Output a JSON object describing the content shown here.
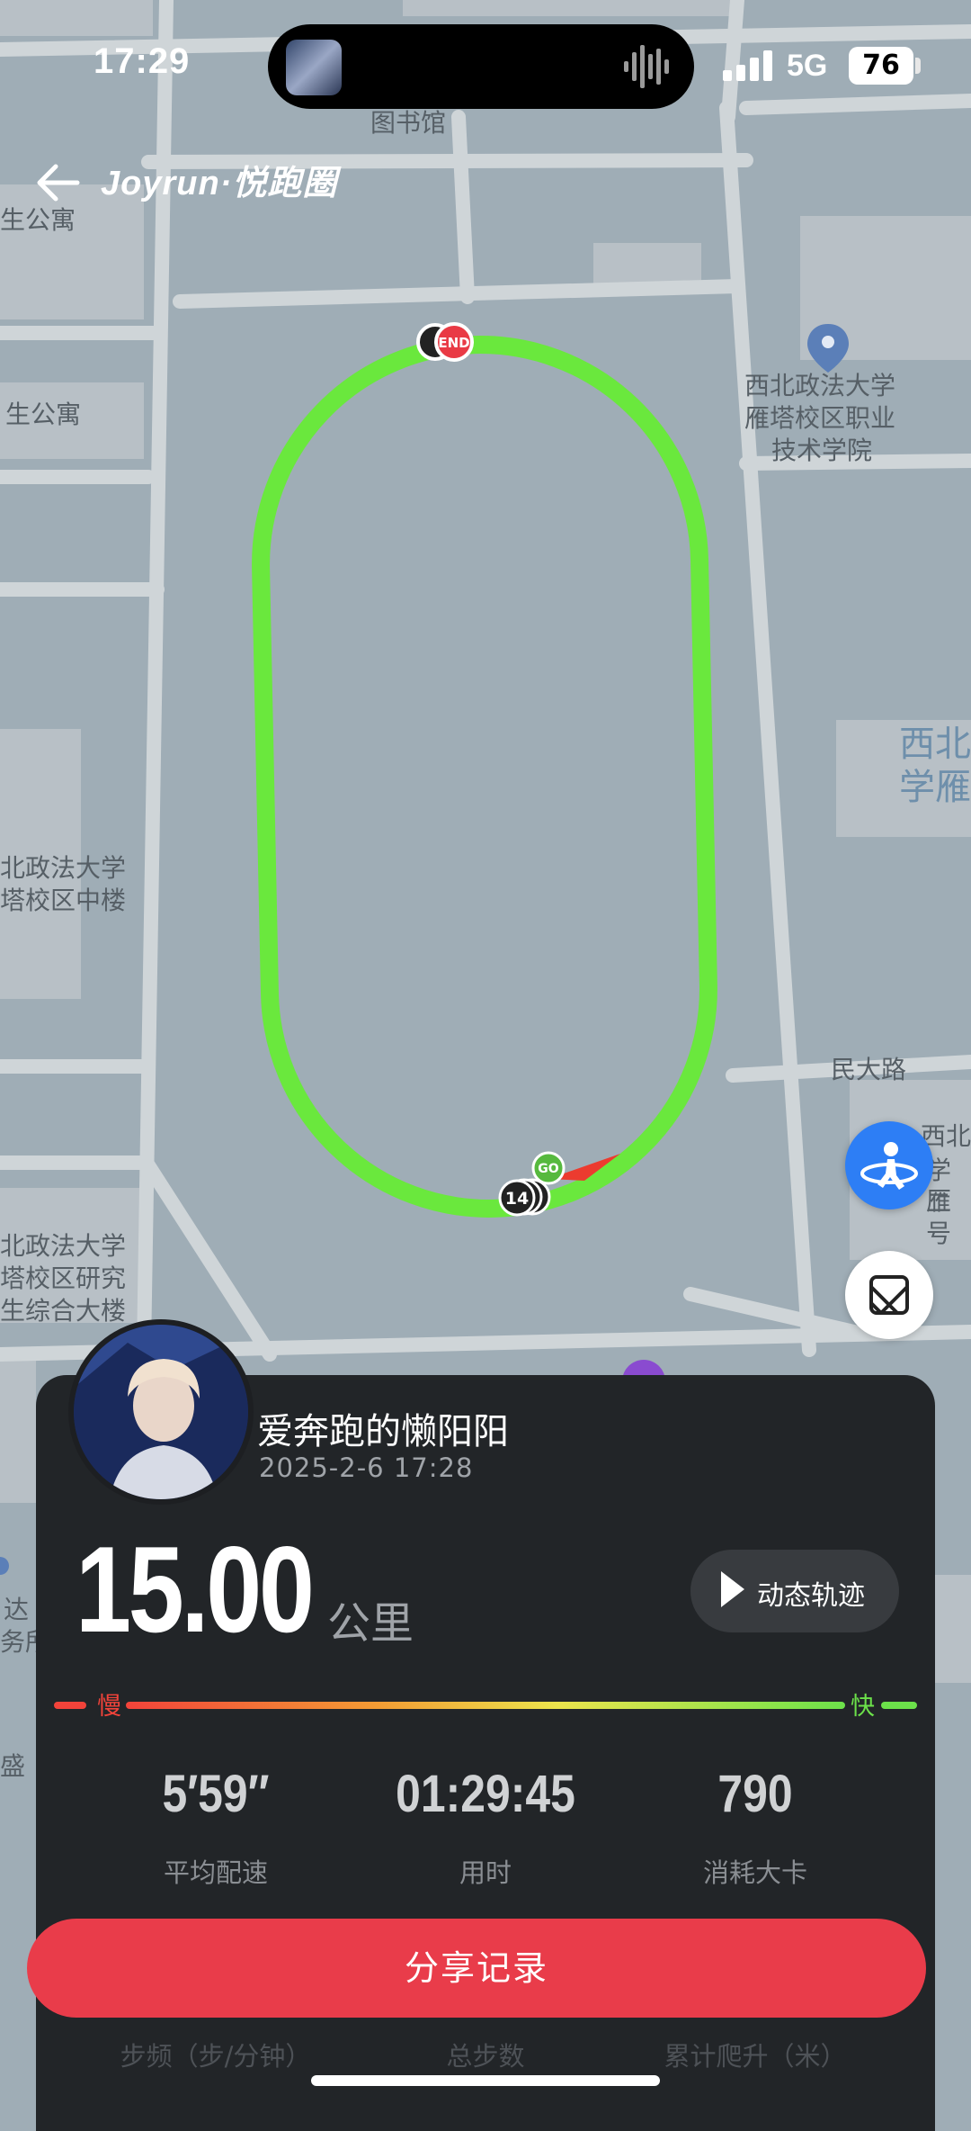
{
  "status_bar": {
    "time": "17:29",
    "network": "5G",
    "battery": "76"
  },
  "nav": {
    "brand": "Joyrun·悦跑圈"
  },
  "map": {
    "labels": [
      "图书馆",
      "生公寓",
      "生公寓",
      "西北政法大学",
      "雁塔校区职业",
      "技术学院",
      "西北",
      "学雁",
      "北政法大学",
      "塔校区中楼",
      "民大路",
      "西北",
      "学雁",
      "二号",
      "北政法大学",
      "塔校区研究",
      "生综合大楼",
      "达",
      "务所",
      "盛"
    ],
    "markers": {
      "end": "END",
      "go": "GO",
      "lap": "14"
    },
    "route_color": "#6ae83d"
  },
  "run": {
    "username": "爱奔跑的懒阳阳",
    "datetime": "2025-2-6 17:28",
    "distance": "15.00",
    "distance_unit": "公里",
    "replay_label": "动态轨迹",
    "pace_slow": "慢",
    "pace_fast": "快",
    "stats": [
      {
        "value": "5′59″",
        "label": "平均配速"
      },
      {
        "value": "01:29:45",
        "label": "用时"
      },
      {
        "value": "790",
        "label": "消耗大卡"
      }
    ],
    "share_label": "分享记录",
    "extra_labels": [
      "步频（步/分钟）",
      "总步数",
      "累计爬升（米）"
    ]
  },
  "colors": {
    "share": "#e93c4a",
    "card": "#222528",
    "locate": "#2d7ef5",
    "slow": "#f2433a",
    "fast": "#6ce14a"
  }
}
